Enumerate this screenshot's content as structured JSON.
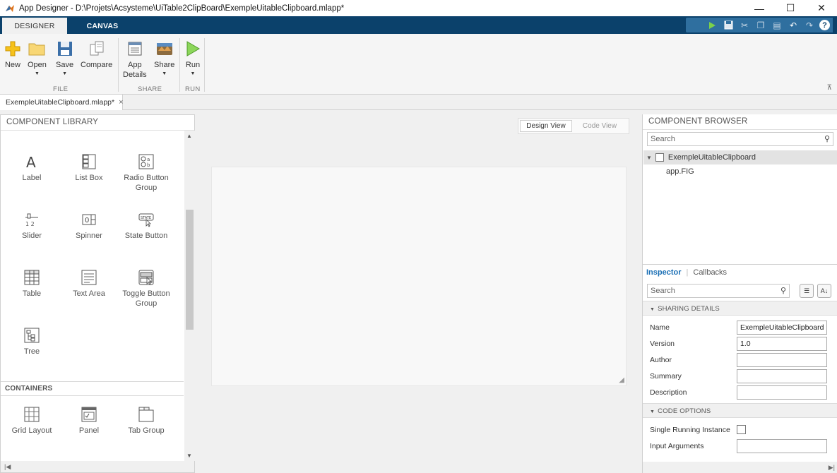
{
  "window": {
    "title": "App Designer - D:\\Projets\\Acsysteme\\UiTable2ClipBoard\\ExempleUitableClipboard.mlapp*",
    "minimize": "—",
    "maximize": "☐",
    "close": "✕"
  },
  "ribbon_tabs": {
    "designer": "DESIGNER",
    "canvas": "CANVAS"
  },
  "toolstrip": {
    "new": "New",
    "open": "Open",
    "save": "Save",
    "compare": "Compare",
    "app_details_1": "App",
    "app_details_2": "Details",
    "share": "Share",
    "run": "Run",
    "group_file": "FILE",
    "group_share": "SHARE",
    "group_run": "RUN"
  },
  "document_tab": {
    "label": "ExempleUitableClipboard.mlapp*",
    "close": "×"
  },
  "component_library": {
    "title": "COMPONENT LIBRARY",
    "items": [
      {
        "label": "Label",
        "icon": "label-icon"
      },
      {
        "label": "List Box",
        "icon": "list-box-icon"
      },
      {
        "label": "Radio Button Group",
        "icon": "radio-button-group-icon"
      },
      {
        "label": "Slider",
        "icon": "slider-icon"
      },
      {
        "label": "Spinner",
        "icon": "spinner-icon"
      },
      {
        "label": "State Button",
        "icon": "state-button-icon"
      },
      {
        "label": "Table",
        "icon": "table-icon"
      },
      {
        "label": "Text Area",
        "icon": "text-area-icon"
      },
      {
        "label": "Toggle Button Group",
        "icon": "toggle-button-group-icon"
      },
      {
        "label": "Tree",
        "icon": "tree-icon"
      }
    ],
    "containers_title": "CONTAINERS",
    "containers": [
      {
        "label": "Grid Layout",
        "icon": "grid-layout-icon"
      },
      {
        "label": "Panel",
        "icon": "panel-icon"
      },
      {
        "label": "Tab Group",
        "icon": "tab-group-icon"
      }
    ]
  },
  "canvas": {
    "design_view": "Design View",
    "code_view": "Code View"
  },
  "component_browser": {
    "title": "COMPONENT BROWSER",
    "search_placeholder": "Search",
    "root": "ExempleUitableClipboard",
    "child": "app.FIG"
  },
  "inspector": {
    "tab_inspector": "Inspector",
    "tab_callbacks": "Callbacks",
    "search_placeholder": "Search",
    "sharing_details": "SHARING DETAILS",
    "code_options": "CODE OPTIONS",
    "props": {
      "name_label": "Name",
      "name_value": "ExempleUitableClipboard",
      "version_label": "Version",
      "version_value": "1.0",
      "author_label": "Author",
      "author_value": "",
      "summary_label": "Summary",
      "summary_value": "",
      "description_label": "Description",
      "description_value": "",
      "single_running_label": "Single Running Instance",
      "single_running_checked": false,
      "input_args_label": "Input Arguments",
      "input_args_value": ""
    }
  },
  "colors": {
    "tab_strip": "#0b416b",
    "accent": "#1a6fb5"
  }
}
